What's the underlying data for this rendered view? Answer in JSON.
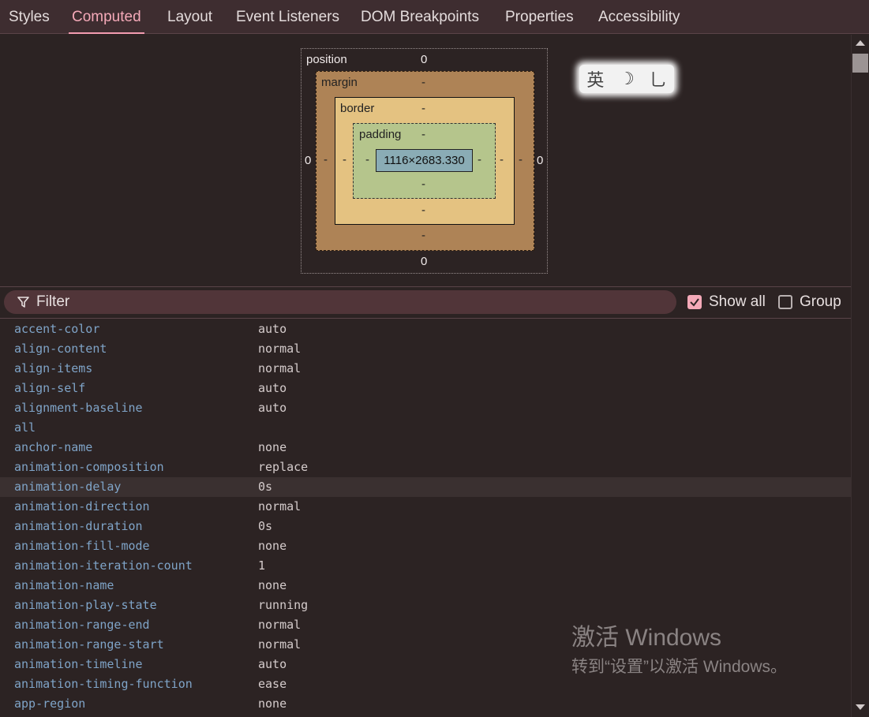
{
  "tabs": [
    {
      "label": "Styles"
    },
    {
      "label": "Computed"
    },
    {
      "label": "Layout"
    },
    {
      "label": "Event Listeners"
    },
    {
      "label": "DOM Breakpoints"
    },
    {
      "label": "Properties"
    },
    {
      "label": "Accessibility"
    }
  ],
  "active_tab": "Computed",
  "box_model": {
    "position_label": "position",
    "position_top": "0",
    "position_bottom": "0",
    "position_left": "0",
    "position_right": "0",
    "margin_label": "margin",
    "margin_top": "-",
    "margin_bottom": "-",
    "margin_left": "-",
    "margin_right": "-",
    "border_label": "border",
    "border_top": "-",
    "border_bottom": "-",
    "border_left": "-",
    "border_right": "-",
    "padding_label": "padding",
    "padding_top": "-",
    "padding_bottom": "-",
    "padding_left": "-",
    "padding_right": "-",
    "content_size": "1116×2683.330"
  },
  "ime": {
    "char1": "英",
    "char2": "☽",
    "char3": "⺃"
  },
  "filter": {
    "placeholder": "Filter"
  },
  "show_all": {
    "label": "Show all",
    "checked": true
  },
  "group": {
    "label": "Group",
    "checked": false
  },
  "properties": [
    {
      "name": "accent-color",
      "value": "auto"
    },
    {
      "name": "align-content",
      "value": "normal"
    },
    {
      "name": "align-items",
      "value": "normal"
    },
    {
      "name": "align-self",
      "value": "auto"
    },
    {
      "name": "alignment-baseline",
      "value": "auto"
    },
    {
      "name": "all",
      "value": ""
    },
    {
      "name": "anchor-name",
      "value": "none"
    },
    {
      "name": "animation-composition",
      "value": "replace"
    },
    {
      "name": "animation-delay",
      "value": "0s"
    },
    {
      "name": "animation-direction",
      "value": "normal"
    },
    {
      "name": "animation-duration",
      "value": "0s"
    },
    {
      "name": "animation-fill-mode",
      "value": "none"
    },
    {
      "name": "animation-iteration-count",
      "value": "1"
    },
    {
      "name": "animation-name",
      "value": "none"
    },
    {
      "name": "animation-play-state",
      "value": "running"
    },
    {
      "name": "animation-range-end",
      "value": "normal"
    },
    {
      "name": "animation-range-start",
      "value": "normal"
    },
    {
      "name": "animation-timeline",
      "value": "auto"
    },
    {
      "name": "animation-timing-function",
      "value": "ease"
    },
    {
      "name": "app-region",
      "value": "none"
    }
  ],
  "highlighted_property": "animation-delay",
  "watermark": {
    "title": "激活 Windows",
    "subtitle": "转到“设置”以激活 Windows。"
  },
  "colors": {
    "accent": "#f4a9b8",
    "background": "#2c2323",
    "property_name": "#7fa4c8"
  }
}
